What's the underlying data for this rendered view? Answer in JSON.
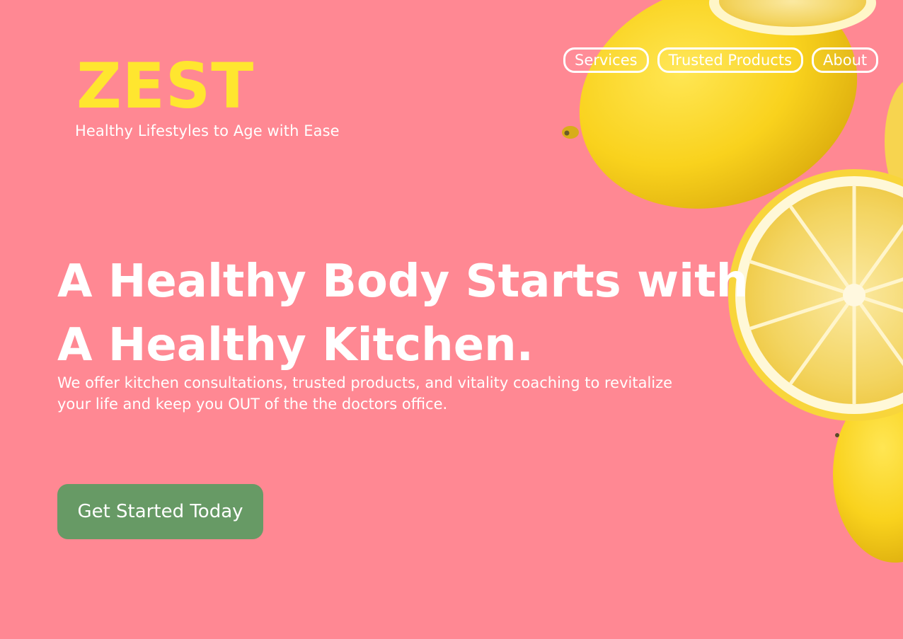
{
  "brand": {
    "logo": "ZEST",
    "tagline": "Healthy Lifestyles to Age with Ease"
  },
  "nav": {
    "items": [
      {
        "label": "Services"
      },
      {
        "label": "Trusted Products"
      },
      {
        "label": "About"
      }
    ]
  },
  "hero": {
    "title_line1": "A Healthy Body Starts with",
    "title_line2": "A Healthy Kitchen.",
    "subtitle_line1": "We offer kitchen consultations, trusted products, and vitality coaching to revitalize",
    "subtitle_line2": "your life and keep you OUT of the the doctors office.",
    "cta_label": "Get Started Today"
  },
  "colors": {
    "background": "#ff8893",
    "logo": "#ffe62f",
    "text": "#ffffff",
    "cta_background": "#679a65",
    "lemon_peel": "#f7cf1e",
    "lemon_flesh": "#f6d867"
  }
}
